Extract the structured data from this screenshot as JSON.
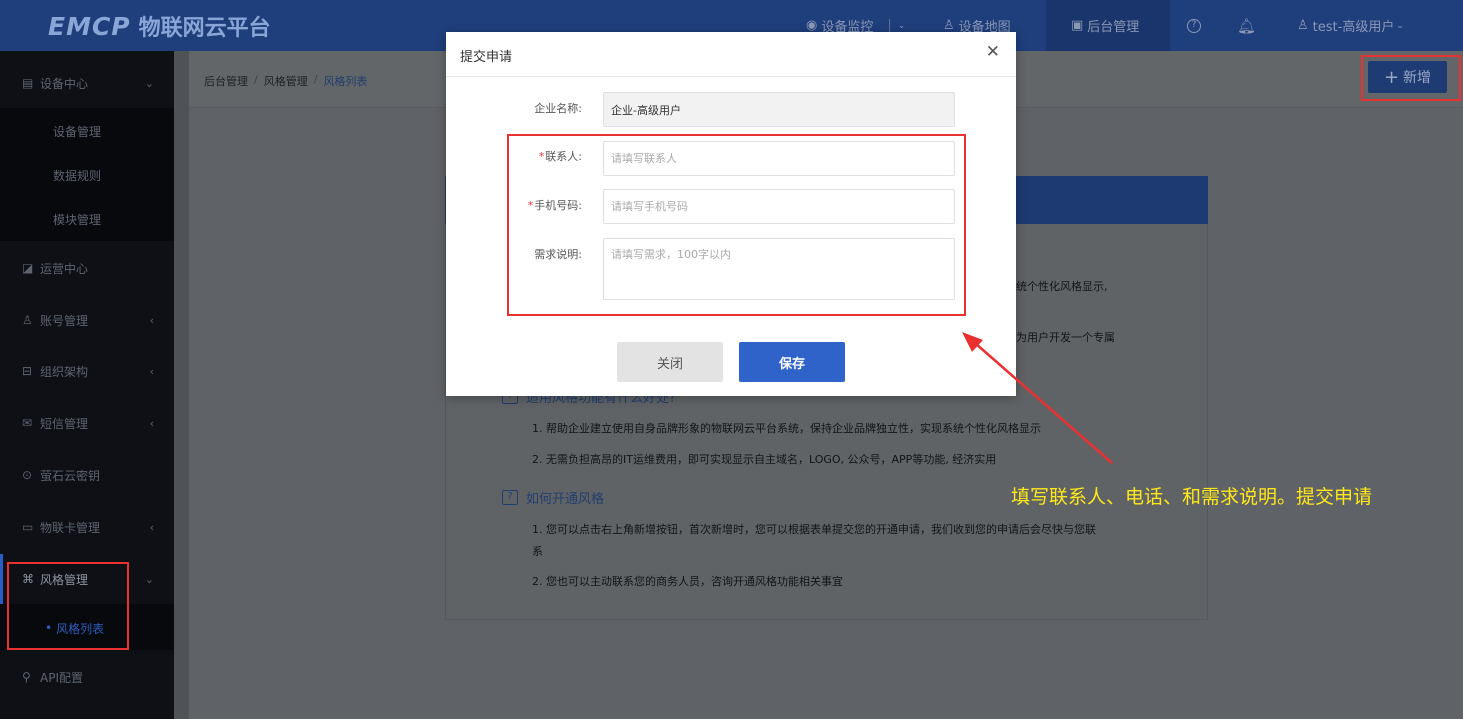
{
  "header": {
    "logo_mark": "EMCP",
    "logo_text": "物联网云平台",
    "nav": [
      "设备监控",
      "设备地图",
      "后台管理"
    ],
    "help_icon": "help-circle-icon",
    "bell_icon": "bell-icon",
    "user": "test-高级用户"
  },
  "sidebar": {
    "items": [
      {
        "label": "设备中心",
        "icon": "device-icon"
      },
      {
        "label": "设备管理"
      },
      {
        "label": "数据规则"
      },
      {
        "label": "模块管理"
      },
      {
        "label": "运营中心",
        "icon": "monitor-icon"
      },
      {
        "label": "账号管理",
        "icon": "user-icon"
      },
      {
        "label": "组织架构",
        "icon": "org-icon"
      },
      {
        "label": "短信管理",
        "icon": "message-icon"
      },
      {
        "label": "萤石云密钥",
        "icon": "key-icon"
      },
      {
        "label": "物联卡管理",
        "icon": "card-icon"
      },
      {
        "label": "风格管理",
        "icon": "style-icon"
      },
      {
        "label": "风格列表"
      },
      {
        "label": "API配置",
        "icon": "link-icon"
      }
    ]
  },
  "breadcrumb": [
    "后台管理",
    "风格管理",
    "风格列表"
  ],
  "add_button": "新增",
  "card": {
    "frag1": "统个性化风格显示,",
    "frag2": "为用户开发一个专属",
    "section1_title": "适用风格功能有什么好处?",
    "section1_items": [
      "1. 帮助企业建立使用自身品牌形象的物联网云平台系统，保持企业品牌独立性，实现系统个性化风格显示",
      "2. 无需负担高昂的IT运维费用，即可实现显示自主域名，LOGO, 公众号，APP等功能, 经济实用"
    ],
    "section2_title": "如何开通风格",
    "section2_items": [
      "1. 您可以点击右上角新增按钮，首次新增时，您可以根据表单提交您的开通申请，我们收到您的申请后会尽快与您联",
      "系",
      "2. 您也可以主动联系您的商务人员，咨询开通风格功能相关事宜"
    ]
  },
  "modal": {
    "title": "提交申请",
    "close_icon": "close-icon",
    "fields": {
      "company_label": "企业名称:",
      "company_value": "企业-高级用户",
      "contact_label": "联系人:",
      "contact_placeholder": "请填写联系人",
      "phone_label": "手机号码:",
      "phone_placeholder": "请填写手机号码",
      "desc_label": "需求说明:",
      "desc_placeholder": "请填写需求，100字以内"
    },
    "close_button": "关闭",
    "save_button": "保存"
  },
  "annotation": "填写联系人、电话、和需求说明。提交申请",
  "colors": {
    "accent": "#2f63c9",
    "highlight": "#e93131",
    "annotation": "#ffe81a"
  }
}
